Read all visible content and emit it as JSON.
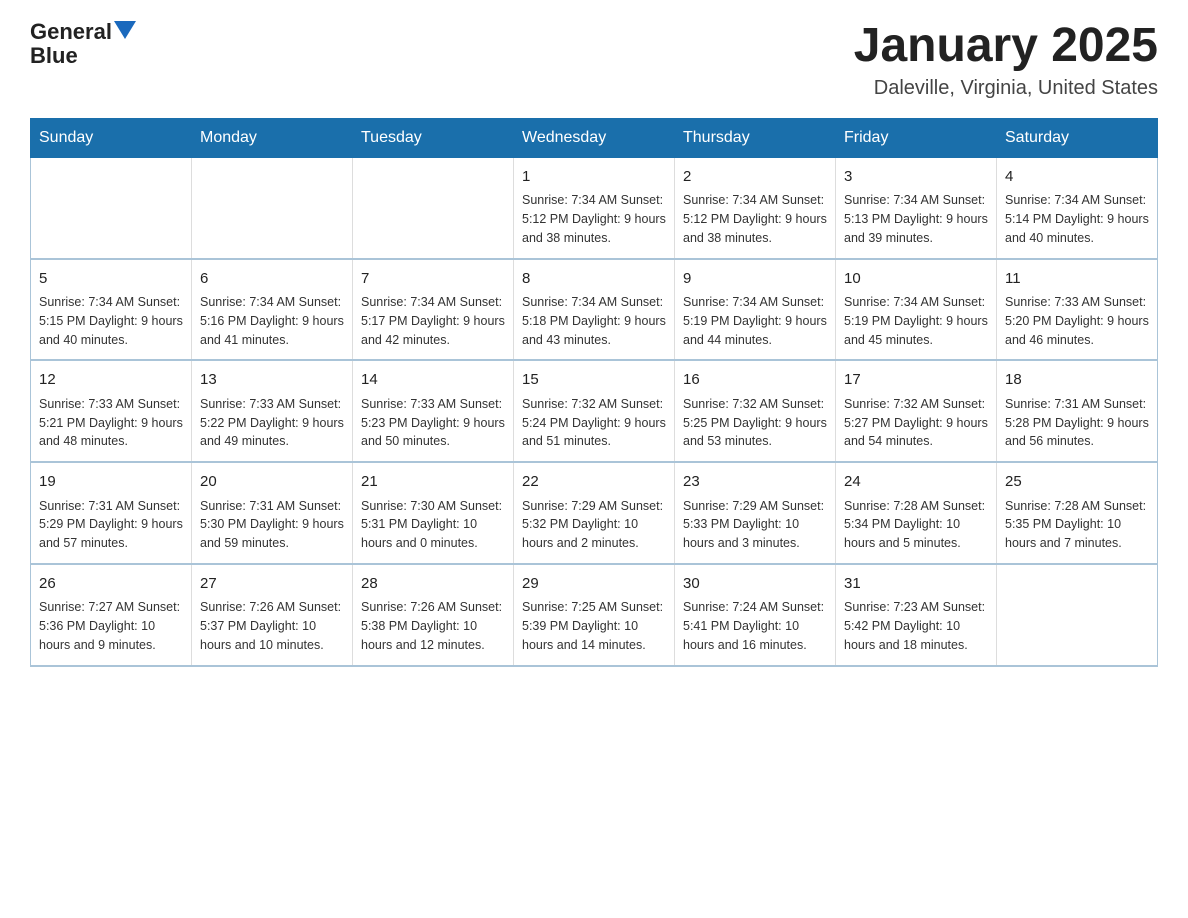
{
  "logo": {
    "text_general": "General",
    "text_blue": "Blue"
  },
  "title": "January 2025",
  "subtitle": "Daleville, Virginia, United States",
  "days_of_week": [
    "Sunday",
    "Monday",
    "Tuesday",
    "Wednesday",
    "Thursday",
    "Friday",
    "Saturday"
  ],
  "weeks": [
    [
      {
        "num": "",
        "info": ""
      },
      {
        "num": "",
        "info": ""
      },
      {
        "num": "",
        "info": ""
      },
      {
        "num": "1",
        "info": "Sunrise: 7:34 AM\nSunset: 5:12 PM\nDaylight: 9 hours and 38 minutes."
      },
      {
        "num": "2",
        "info": "Sunrise: 7:34 AM\nSunset: 5:12 PM\nDaylight: 9 hours and 38 minutes."
      },
      {
        "num": "3",
        "info": "Sunrise: 7:34 AM\nSunset: 5:13 PM\nDaylight: 9 hours and 39 minutes."
      },
      {
        "num": "4",
        "info": "Sunrise: 7:34 AM\nSunset: 5:14 PM\nDaylight: 9 hours and 40 minutes."
      }
    ],
    [
      {
        "num": "5",
        "info": "Sunrise: 7:34 AM\nSunset: 5:15 PM\nDaylight: 9 hours and 40 minutes."
      },
      {
        "num": "6",
        "info": "Sunrise: 7:34 AM\nSunset: 5:16 PM\nDaylight: 9 hours and 41 minutes."
      },
      {
        "num": "7",
        "info": "Sunrise: 7:34 AM\nSunset: 5:17 PM\nDaylight: 9 hours and 42 minutes."
      },
      {
        "num": "8",
        "info": "Sunrise: 7:34 AM\nSunset: 5:18 PM\nDaylight: 9 hours and 43 minutes."
      },
      {
        "num": "9",
        "info": "Sunrise: 7:34 AM\nSunset: 5:19 PM\nDaylight: 9 hours and 44 minutes."
      },
      {
        "num": "10",
        "info": "Sunrise: 7:34 AM\nSunset: 5:19 PM\nDaylight: 9 hours and 45 minutes."
      },
      {
        "num": "11",
        "info": "Sunrise: 7:33 AM\nSunset: 5:20 PM\nDaylight: 9 hours and 46 minutes."
      }
    ],
    [
      {
        "num": "12",
        "info": "Sunrise: 7:33 AM\nSunset: 5:21 PM\nDaylight: 9 hours and 48 minutes."
      },
      {
        "num": "13",
        "info": "Sunrise: 7:33 AM\nSunset: 5:22 PM\nDaylight: 9 hours and 49 minutes."
      },
      {
        "num": "14",
        "info": "Sunrise: 7:33 AM\nSunset: 5:23 PM\nDaylight: 9 hours and 50 minutes."
      },
      {
        "num": "15",
        "info": "Sunrise: 7:32 AM\nSunset: 5:24 PM\nDaylight: 9 hours and 51 minutes."
      },
      {
        "num": "16",
        "info": "Sunrise: 7:32 AM\nSunset: 5:25 PM\nDaylight: 9 hours and 53 minutes."
      },
      {
        "num": "17",
        "info": "Sunrise: 7:32 AM\nSunset: 5:27 PM\nDaylight: 9 hours and 54 minutes."
      },
      {
        "num": "18",
        "info": "Sunrise: 7:31 AM\nSunset: 5:28 PM\nDaylight: 9 hours and 56 minutes."
      }
    ],
    [
      {
        "num": "19",
        "info": "Sunrise: 7:31 AM\nSunset: 5:29 PM\nDaylight: 9 hours and 57 minutes."
      },
      {
        "num": "20",
        "info": "Sunrise: 7:31 AM\nSunset: 5:30 PM\nDaylight: 9 hours and 59 minutes."
      },
      {
        "num": "21",
        "info": "Sunrise: 7:30 AM\nSunset: 5:31 PM\nDaylight: 10 hours and 0 minutes."
      },
      {
        "num": "22",
        "info": "Sunrise: 7:29 AM\nSunset: 5:32 PM\nDaylight: 10 hours and 2 minutes."
      },
      {
        "num": "23",
        "info": "Sunrise: 7:29 AM\nSunset: 5:33 PM\nDaylight: 10 hours and 3 minutes."
      },
      {
        "num": "24",
        "info": "Sunrise: 7:28 AM\nSunset: 5:34 PM\nDaylight: 10 hours and 5 minutes."
      },
      {
        "num": "25",
        "info": "Sunrise: 7:28 AM\nSunset: 5:35 PM\nDaylight: 10 hours and 7 minutes."
      }
    ],
    [
      {
        "num": "26",
        "info": "Sunrise: 7:27 AM\nSunset: 5:36 PM\nDaylight: 10 hours and 9 minutes."
      },
      {
        "num": "27",
        "info": "Sunrise: 7:26 AM\nSunset: 5:37 PM\nDaylight: 10 hours and 10 minutes."
      },
      {
        "num": "28",
        "info": "Sunrise: 7:26 AM\nSunset: 5:38 PM\nDaylight: 10 hours and 12 minutes."
      },
      {
        "num": "29",
        "info": "Sunrise: 7:25 AM\nSunset: 5:39 PM\nDaylight: 10 hours and 14 minutes."
      },
      {
        "num": "30",
        "info": "Sunrise: 7:24 AM\nSunset: 5:41 PM\nDaylight: 10 hours and 16 minutes."
      },
      {
        "num": "31",
        "info": "Sunrise: 7:23 AM\nSunset: 5:42 PM\nDaylight: 10 hours and 18 minutes."
      },
      {
        "num": "",
        "info": ""
      }
    ]
  ]
}
